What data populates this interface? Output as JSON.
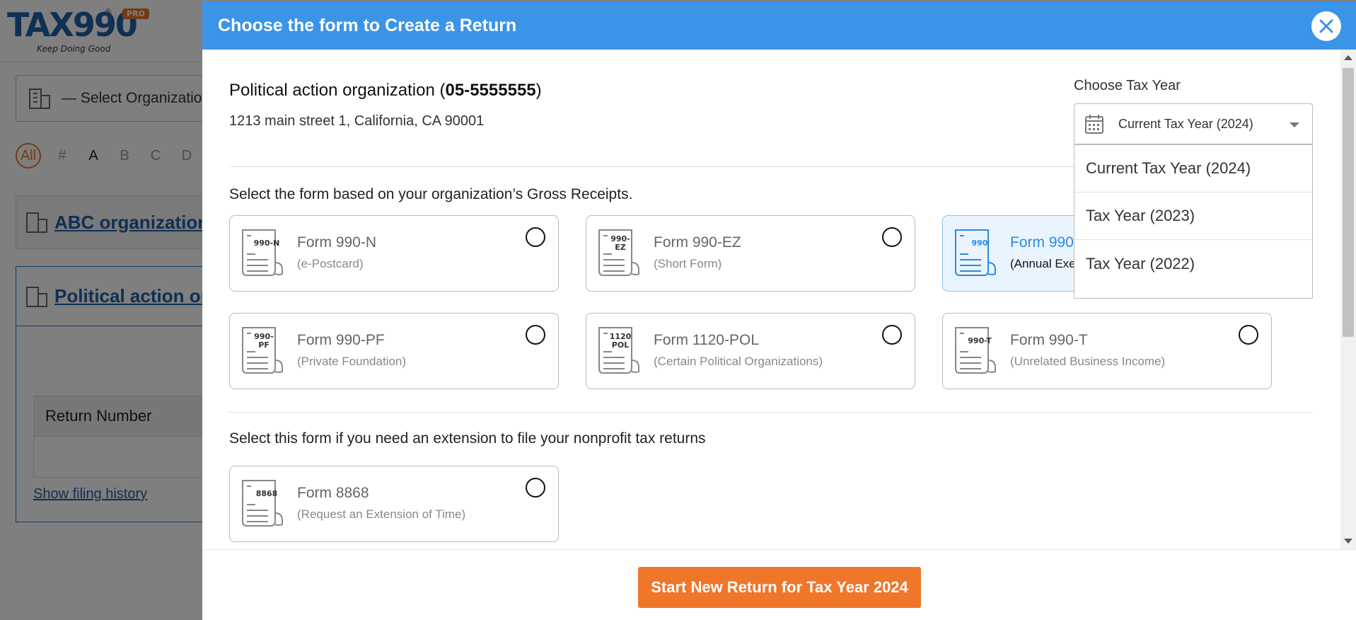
{
  "app": {
    "logo_text": "TAX990",
    "logo_badge": "PRO",
    "logo_reg": "®",
    "tagline": "Keep Doing Good"
  },
  "background": {
    "org_select_placeholder": "— Select Organizatio...",
    "alphabet": [
      "All",
      "#",
      "A",
      "B",
      "C",
      "D"
    ],
    "org_cards": [
      "ABC organization",
      "Political action or"
    ],
    "table_header": "Return Number",
    "history_link": "Show filing history"
  },
  "modal": {
    "title": "Choose the form to Create a Return",
    "organization": {
      "name": "Political action organization",
      "ein": "05-5555555",
      "address": "1213 main street 1, California, CA 90001"
    },
    "tax_year": {
      "label": "Choose Tax Year",
      "selected": "Current Tax Year (2024)",
      "options": [
        "Current Tax Year (2024)",
        "Tax Year (2023)",
        "Tax Year (2022)"
      ]
    },
    "gross_receipts_label": "Select the form based on your organization’s Gross Receipts.",
    "forms": [
      {
        "code": "990-N",
        "icon_label": "990-N",
        "title": "Form 990-N",
        "subtitle": "(e-Postcard)",
        "selected": false
      },
      {
        "code": "990-EZ",
        "icon_label": "990-EZ",
        "title": "Form 990-EZ",
        "subtitle": "(Short Form)",
        "selected": false
      },
      {
        "code": "990",
        "icon_label": "990",
        "title": "Form 990",
        "subtitle": "(Annual Exe",
        "selected": true
      },
      {
        "code": "990-PF",
        "icon_label": "990-PF",
        "title": "Form 990-PF",
        "subtitle": "(Private Foundation)",
        "selected": false
      },
      {
        "code": "1120-POL",
        "icon_label": "1120 POL",
        "title": "Form 1120-POL",
        "subtitle": "(Certain Political Organizations)",
        "selected": false
      },
      {
        "code": "990-T",
        "icon_label": "990-T",
        "title": "Form 990-T",
        "subtitle": "(Unrelated Business Income)",
        "selected": false
      }
    ],
    "extension_label": "Select this form if you need an extension to file your nonprofit tax returns",
    "extension_form": {
      "code": "8868",
      "icon_label": "8868",
      "title": "Form 8868",
      "subtitle": "(Request an Extension of Time)",
      "selected": false
    },
    "start_button": "Start New Return for Tax Year 2024"
  },
  "colors": {
    "header_blue": "#3a94e8",
    "accent_orange": "#f0762a",
    "brand_blue": "#1f5fa8"
  }
}
